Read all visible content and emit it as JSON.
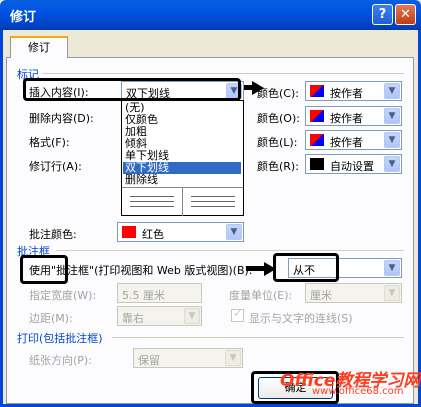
{
  "window": {
    "title": "修订",
    "help_glyph": "?",
    "close_glyph": "✕"
  },
  "tab": {
    "label": "修订"
  },
  "markup": {
    "section": "标记",
    "insert": {
      "label": "插入内容(I):",
      "value": "双下划线"
    },
    "delete": {
      "label": "删除内容(D):"
    },
    "format": {
      "label": "格式(F):"
    },
    "changed_lines": {
      "label": "修订行(A):"
    },
    "color_labels": [
      "颜色(C):",
      "颜色(O):",
      "颜色(L):",
      "颜色(R):"
    ],
    "colors": [
      "按作者",
      "按作者",
      "按作者",
      "自动设置"
    ],
    "comment_color": {
      "label": "批注颜色:",
      "value": "红色"
    },
    "dropdown_options": [
      "(无)",
      "仅颜色",
      "加粗",
      "倾斜",
      "单下划线",
      "双下划线",
      "删除线"
    ],
    "dropdown_selected": 5
  },
  "balloons": {
    "section": "批注框",
    "use": {
      "label": "使用\"批注框\"(打印视图和 Web 版式视图)(B):",
      "value": "从不"
    },
    "width": {
      "label": "指定宽度(W):",
      "value": "5.5 厘米"
    },
    "unit": {
      "label": "度量单位(E):",
      "value": "厘米"
    },
    "margin": {
      "label": "边距(M):",
      "value": "靠右"
    },
    "lines": {
      "label": "显示与文字的连线(S)"
    }
  },
  "printing": {
    "section": "打印(包括批注框)",
    "orientation": {
      "label": "纸张方向(P):",
      "value": "保留"
    }
  },
  "buttons": {
    "ok": "确定"
  },
  "watermark": {
    "brand": "Office教程学习网",
    "url": "www.office68.com"
  },
  "colors": {
    "titlebar": "#0054e3",
    "section": "#0046d5",
    "selection": "#316ac5"
  },
  "icons": {
    "dropdown_arrow": "▼"
  }
}
